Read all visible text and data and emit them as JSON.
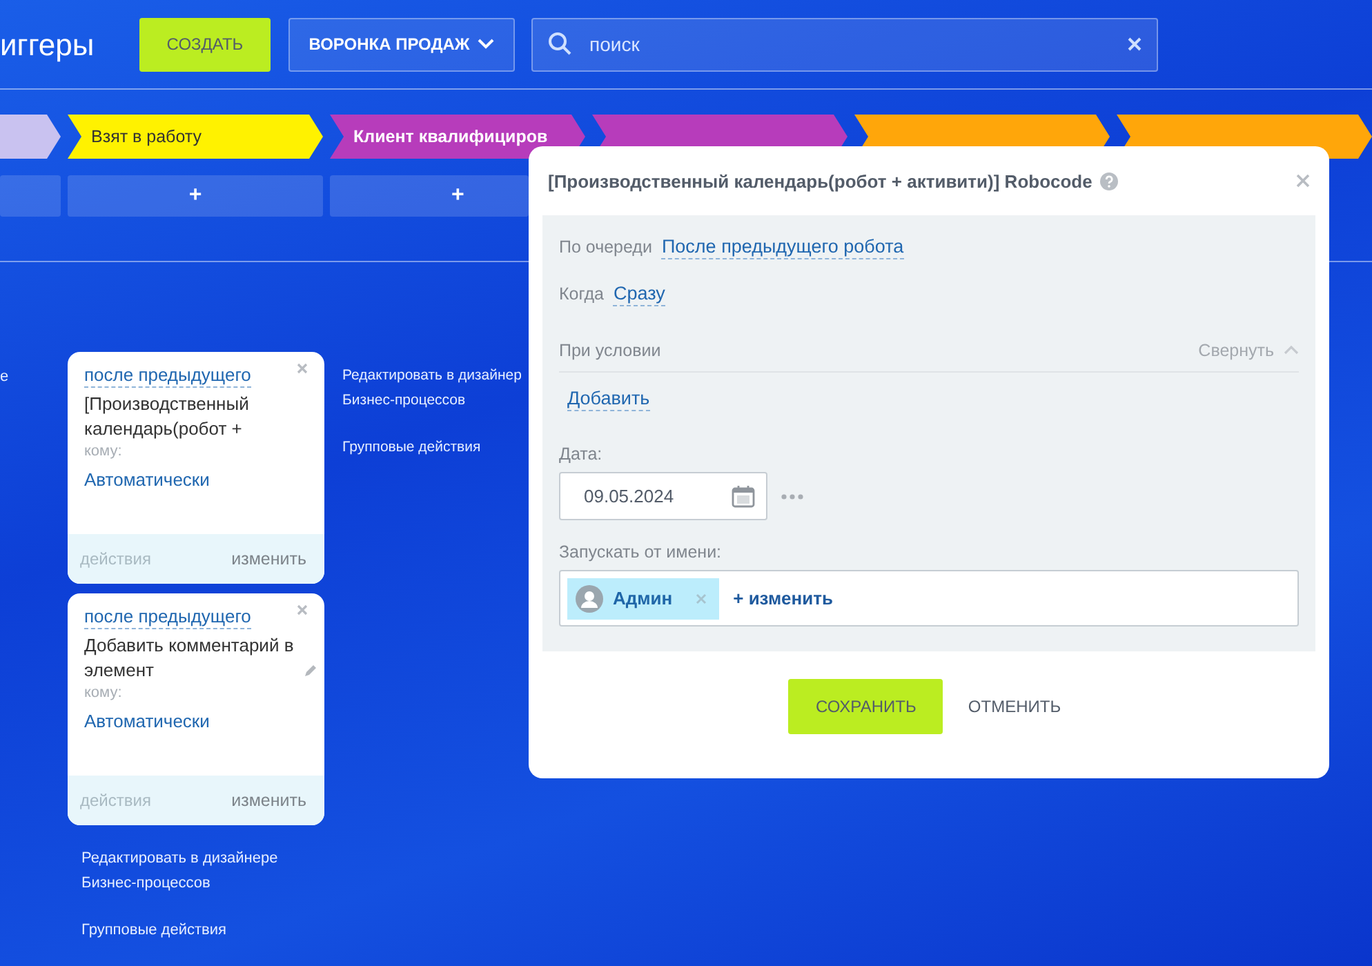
{
  "header": {
    "title": "иггеры",
    "create_button": "СОЗДАТЬ",
    "funnel_button": "ВОРОНКА ПРОДАЖ",
    "search": {
      "placeholder": "поиск"
    }
  },
  "stages": [
    {
      "color": "#c9c2f0"
    },
    {
      "label": "Взят в работу",
      "color": "#fff200"
    },
    {
      "label": "Клиент квалифициров",
      "color": "#b73cbb"
    },
    {
      "color": "#b73cbb"
    },
    {
      "color": "#ffa60a"
    },
    {
      "color": "#ffa60a"
    }
  ],
  "add_row": [
    "+",
    "+"
  ],
  "left_fragment": "е",
  "robots": [
    {
      "order": "после предыдущего",
      "title": "[Производственный календарь(робот +",
      "edited": false,
      "to_label": "кому:",
      "to_value": "Автоматически",
      "actions": "действия",
      "change": "изменить"
    },
    {
      "order": "после предыдущего",
      "title": "Добавить комментарий в элемент",
      "edited": true,
      "to_label": "кому:",
      "to_value": "Автоматически",
      "actions": "действия",
      "change": "изменить"
    }
  ],
  "column_links": [
    [
      "Редактировать в дизайнере Бизнес-процессов",
      "Групповые действия"
    ],
    [
      "Редактировать в дизайнер Бизнес-процессов",
      "Групповые действия"
    ]
  ],
  "dialog": {
    "title": "[Производственный календарь(робот + активити)] Robocode",
    "order_label": "По очереди",
    "order_value": "После предыдущего робота",
    "when_label": "Когда",
    "when_value": "Сразу",
    "condition_label": "При условии",
    "collapse": "Свернуть",
    "add": "Добавить",
    "date_label": "Дата:",
    "date_value": "09.05.2024",
    "run_as_label": "Запускать от имени:",
    "user": "Админ",
    "change_user": "+ изменить",
    "save": "СОХРАНИТЬ",
    "cancel": "ОТМЕНИТЬ"
  }
}
